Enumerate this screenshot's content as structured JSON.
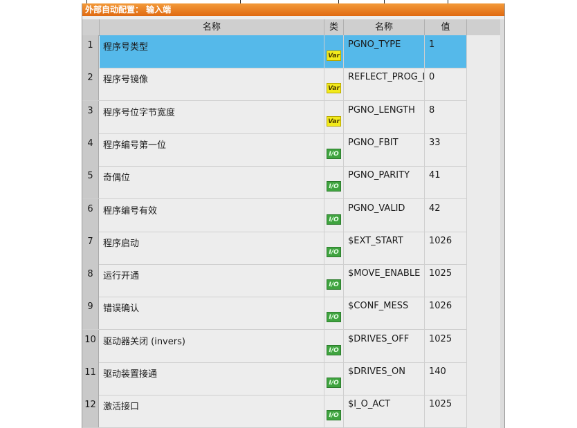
{
  "window": {
    "title": "外部自动配置： 输入端"
  },
  "columns": {
    "name": "名称",
    "type": "类",
    "variable": "名称",
    "value": "值"
  },
  "rows": [
    {
      "num": "1",
      "name": "程序号类型",
      "type": "Var",
      "variable": "PGNO_TYPE",
      "value": "1",
      "selected": true
    },
    {
      "num": "2",
      "name": "程序号镜像",
      "type": "Var",
      "variable": "REFLECT_PROG_I",
      "value": "0"
    },
    {
      "num": "3",
      "name": "程序号位字节宽度",
      "type": "Var",
      "variable": "PGNO_LENGTH",
      "value": "8"
    },
    {
      "num": "4",
      "name": "程序编号第一位",
      "type": "I/O",
      "variable": "PGNO_FBIT",
      "value": "33"
    },
    {
      "num": "5",
      "name": "奇偶位",
      "type": "I/O",
      "variable": "PGNO_PARITY",
      "value": "41"
    },
    {
      "num": "6",
      "name": "程序编号有效",
      "type": "I/O",
      "variable": "PGNO_VALID",
      "value": "42"
    },
    {
      "num": "7",
      "name": "程序启动",
      "type": "I/O",
      "variable": "$EXT_START",
      "value": "1026"
    },
    {
      "num": "8",
      "name": "运行开通",
      "type": "I/O",
      "variable": "$MOVE_ENABLE",
      "value": "1025"
    },
    {
      "num": "9",
      "name": "错误确认",
      "type": "I/O",
      "variable": "$CONF_MESS",
      "value": "1026"
    },
    {
      "num": "10",
      "name": "驱动器关闭 (invers)",
      "type": "I/O",
      "variable": "$DRIVES_OFF",
      "value": "1025"
    },
    {
      "num": "11",
      "name": "驱动装置接通",
      "type": "I/O",
      "variable": "$DRIVES_ON",
      "value": "140"
    },
    {
      "num": "12",
      "name": "激活接口",
      "type": "I/O",
      "variable": "$I_O_ACT",
      "value": "1025"
    }
  ],
  "colors": {
    "titlebar": "#e06a12",
    "selected_row": "#55b9ea",
    "var_badge": "#f2ea1c",
    "io_badge": "#3fa33f"
  }
}
